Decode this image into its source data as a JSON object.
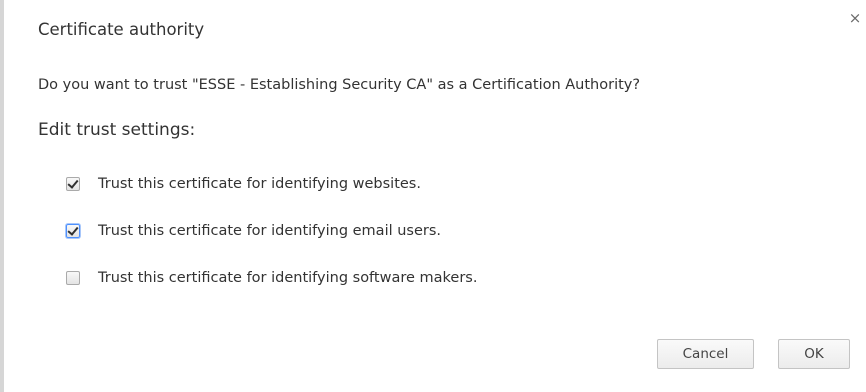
{
  "dialog": {
    "title": "Certificate authority",
    "close_icon": "close-icon",
    "close_glyph": "×",
    "question": "Do you want to trust \"ESSE - Establishing Security CA\" as a Certification Authority?",
    "section_heading": "Edit trust settings:",
    "options": [
      {
        "label": "Trust this certificate for identifying websites.",
        "checked": true
      },
      {
        "label": "Trust this certificate for identifying email users.",
        "checked": true
      },
      {
        "label": "Trust this certificate for identifying software makers.",
        "checked": false
      }
    ],
    "buttons": {
      "cancel_label": "Cancel",
      "ok_label": "OK"
    }
  }
}
